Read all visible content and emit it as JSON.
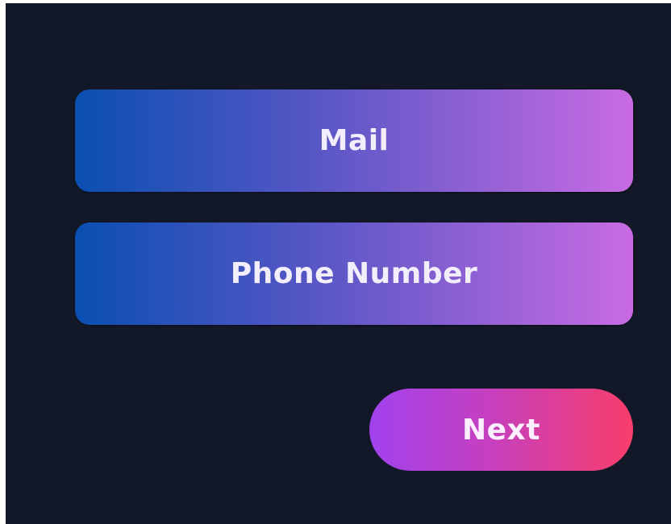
{
  "options": {
    "mail_label": "Mail",
    "phone_label": "Phone Number"
  },
  "actions": {
    "next_label": "Next"
  },
  "colors": {
    "background": "#121827",
    "option_gradient_start": "#0a4fb2",
    "option_gradient_end": "#c96be3",
    "next_gradient_start": "#a142ee",
    "next_gradient_end": "#f83e6a"
  }
}
